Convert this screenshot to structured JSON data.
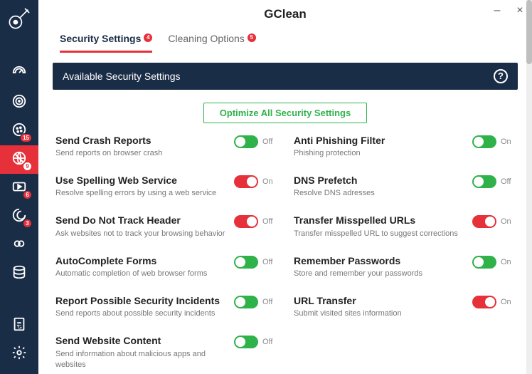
{
  "app": {
    "title": "GClean"
  },
  "sidebar": {
    "items": [
      {
        "name": "dashboard-icon",
        "badge": null
      },
      {
        "name": "target-icon",
        "badge": null
      },
      {
        "name": "cookie-icon",
        "badge": "15"
      },
      {
        "name": "globe-block-icon",
        "badge": "9",
        "active": true
      },
      {
        "name": "video-icon",
        "badge": "6"
      },
      {
        "name": "swirl-icon",
        "badge": "3"
      },
      {
        "name": "link-icon",
        "badge": null
      },
      {
        "name": "database-icon",
        "badge": null
      }
    ],
    "bottom": [
      {
        "name": "report-icon"
      },
      {
        "name": "settings-gear-icon"
      }
    ]
  },
  "tabs": [
    {
      "label": "Security Settings",
      "badge": "4",
      "active": true
    },
    {
      "label": "Cleaning Options",
      "badge": "5",
      "active": false
    }
  ],
  "section": {
    "title": "Available Security Settings"
  },
  "optimize": {
    "label": "Optimize All Security Settings"
  },
  "settings": [
    {
      "title": "Send Crash Reports",
      "desc": "Send reports on browser crash",
      "color": "green",
      "state": "Off"
    },
    {
      "title": "Anti Phishing Filter",
      "desc": "Phishing protection",
      "color": "green",
      "state": "On"
    },
    {
      "title": "Use Spelling Web Service",
      "desc": "Resolve spelling errors by using a web service",
      "color": "red",
      "state": "On"
    },
    {
      "title": "DNS Prefetch",
      "desc": "Resolve DNS adresses",
      "color": "green",
      "state": "Off"
    },
    {
      "title": "Send Do Not Track Header",
      "desc": "Ask websites not to track your browsing behavior",
      "color": "red",
      "state": "Off"
    },
    {
      "title": "Transfer Misspelled URLs",
      "desc": "Transfer misspelled URL to suggest corrections",
      "color": "red",
      "state": "On"
    },
    {
      "title": "AutoComplete Forms",
      "desc": "Automatic completion of web browser forms",
      "color": "green",
      "state": "Off"
    },
    {
      "title": "Remember Passwords",
      "desc": "Store and remember your passwords",
      "color": "green",
      "state": "On"
    },
    {
      "title": "Report Possible Security Incidents",
      "desc": "Send reports about possible security incidents",
      "color": "green",
      "state": "Off"
    },
    {
      "title": "URL Transfer",
      "desc": "Submit visited sites information",
      "color": "red",
      "state": "On"
    },
    {
      "title": "Send Website Content",
      "desc": "Send information about malicious apps and websites",
      "color": "green",
      "state": "Off"
    }
  ]
}
